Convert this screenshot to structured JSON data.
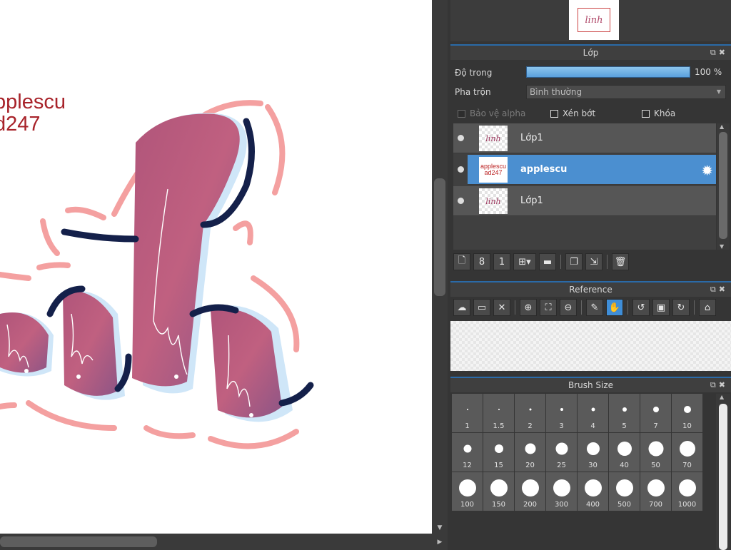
{
  "canvas": {
    "text_line1": "pplescu",
    "text_line2": "d247",
    "text_color": "#a8232a"
  },
  "navigator": {
    "thumb_text": "linh"
  },
  "layer_panel": {
    "title": "Lớp",
    "opacity_label": "Độ trong",
    "opacity_value": "100 %",
    "opacity_fraction": 1.0,
    "blend_label": "Pha trộn",
    "blend_value": "Bình thường",
    "protect_alpha": "Bảo vệ alpha",
    "clipping": "Xén bớt",
    "lock": "Khóa",
    "layers": [
      {
        "name": "Lớp1",
        "thumb": "linh",
        "selected": false
      },
      {
        "name": "applescu",
        "thumb": "applescu ad247",
        "selected": true
      },
      {
        "name": "Lớp1",
        "thumb": "linh",
        "selected": false
      }
    ],
    "toolbar_icons": [
      "new-layer-icon",
      "new-8bit-layer-icon",
      "new-1bit-layer-icon",
      "add-layer-menu-icon",
      "folder-icon",
      "duplicate-icon",
      "merge-icon",
      "delete-icon"
    ]
  },
  "reference_panel": {
    "title": "Reference",
    "toolbar_icons": [
      "upload-icon",
      "open-folder-icon",
      "close-icon",
      "zoom-in-icon",
      "fit-icon",
      "zoom-out-icon",
      "eyedropper-icon",
      "hand-icon",
      "rotate-left-icon",
      "fit-screen-icon",
      "rotate-right-icon",
      "lock-icon"
    ]
  },
  "brush_panel": {
    "title": "Brush Size",
    "sizes": [
      "1",
      "1.5",
      "2",
      "3",
      "4",
      "5",
      "7",
      "10",
      "12",
      "15",
      "20",
      "25",
      "30",
      "40",
      "50",
      "70",
      "100",
      "150",
      "200",
      "300",
      "400",
      "500",
      "700",
      "1000"
    ]
  }
}
